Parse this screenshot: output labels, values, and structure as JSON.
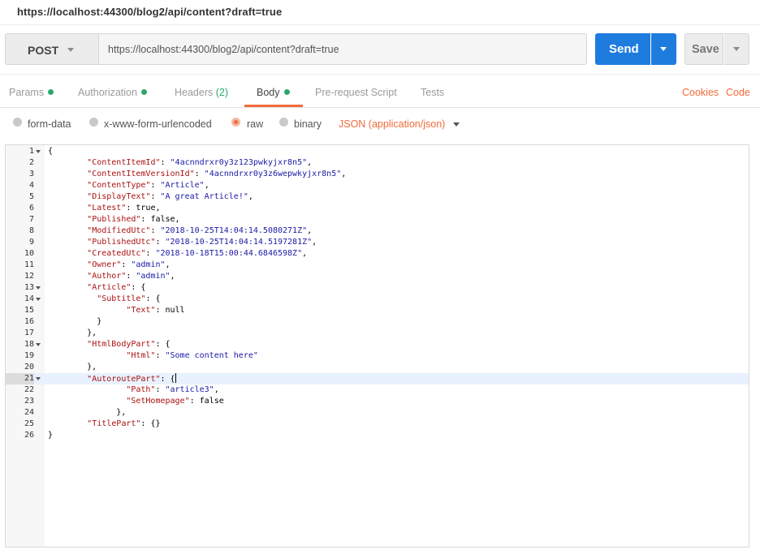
{
  "window": {
    "title": "https://localhost:44300/blog2/api/content?draft=true"
  },
  "request": {
    "method": "POST",
    "url": "https://localhost:44300/blog2/api/content?draft=true",
    "send_label": "Send",
    "save_label": "Save"
  },
  "tabs": [
    {
      "label": "Params",
      "dot": true
    },
    {
      "label": "Authorization",
      "dot": true
    },
    {
      "label": "Headers",
      "count": "(2)"
    },
    {
      "label": "Body",
      "dot": true,
      "active": true
    },
    {
      "label": "Pre-request Script"
    },
    {
      "label": "Tests"
    }
  ],
  "links": {
    "cookies": "Cookies",
    "code": "Code"
  },
  "body_types": [
    {
      "label": "form-data",
      "selected": false
    },
    {
      "label": "x-www-form-urlencoded",
      "selected": false
    },
    {
      "label": "raw",
      "selected": true
    },
    {
      "label": "binary",
      "selected": false
    }
  ],
  "raw_format": "JSON (application/json)",
  "colors": {
    "accent": "#f26b3a",
    "send": "#1f7cdf",
    "dot": "#2aa86b",
    "json_key": "#a11",
    "json_string": "#1a1aa6"
  },
  "editor": {
    "active_line": 21,
    "lines": [
      {
        "n": "1",
        "fold": true,
        "parts": [
          [
            "p",
            "{"
          ]
        ]
      },
      {
        "n": "2",
        "parts": [
          [
            "p",
            "        "
          ],
          [
            "k",
            "\"ContentItemId\""
          ],
          [
            "p",
            ": "
          ],
          [
            "s",
            "\"4acnndrxr0y3z123pwkyjxr8n5\""
          ],
          [
            "p",
            ","
          ]
        ]
      },
      {
        "n": "3",
        "parts": [
          [
            "p",
            "        "
          ],
          [
            "k",
            "\"ContentItemVersionId\""
          ],
          [
            "p",
            ": "
          ],
          [
            "s",
            "\"4acnndrxr0y3z6wepwkyjxr8n5\""
          ],
          [
            "p",
            ","
          ]
        ]
      },
      {
        "n": "4",
        "parts": [
          [
            "p",
            "        "
          ],
          [
            "k",
            "\"ContentType\""
          ],
          [
            "p",
            ": "
          ],
          [
            "s",
            "\"Article\""
          ],
          [
            "p",
            ","
          ]
        ]
      },
      {
        "n": "5",
        "parts": [
          [
            "p",
            "        "
          ],
          [
            "k",
            "\"DisplayText\""
          ],
          [
            "p",
            ": "
          ],
          [
            "s",
            "\"A great Article!\""
          ],
          [
            "p",
            ","
          ]
        ]
      },
      {
        "n": "6",
        "parts": [
          [
            "p",
            "        "
          ],
          [
            "k",
            "\"Latest\""
          ],
          [
            "p",
            ": true,"
          ]
        ]
      },
      {
        "n": "7",
        "parts": [
          [
            "p",
            "        "
          ],
          [
            "k",
            "\"Published\""
          ],
          [
            "p",
            ": false,"
          ]
        ]
      },
      {
        "n": "8",
        "parts": [
          [
            "p",
            "        "
          ],
          [
            "k",
            "\"ModifiedUtc\""
          ],
          [
            "p",
            ": "
          ],
          [
            "s",
            "\"2018-10-25T14:04:14.5080271Z\""
          ],
          [
            "p",
            ","
          ]
        ]
      },
      {
        "n": "9",
        "parts": [
          [
            "p",
            "        "
          ],
          [
            "k",
            "\"PublishedUtc\""
          ],
          [
            "p",
            ": "
          ],
          [
            "s",
            "\"2018-10-25T14:04:14.5197281Z\""
          ],
          [
            "p",
            ","
          ]
        ]
      },
      {
        "n": "10",
        "parts": [
          [
            "p",
            "        "
          ],
          [
            "k",
            "\"CreatedUtc\""
          ],
          [
            "p",
            ": "
          ],
          [
            "s",
            "\"2018-10-18T15:00:44.6846598Z\""
          ],
          [
            "p",
            ","
          ]
        ]
      },
      {
        "n": "11",
        "parts": [
          [
            "p",
            "        "
          ],
          [
            "k",
            "\"Owner\""
          ],
          [
            "p",
            ": "
          ],
          [
            "s",
            "\"admin\""
          ],
          [
            "p",
            ","
          ]
        ]
      },
      {
        "n": "12",
        "parts": [
          [
            "p",
            "        "
          ],
          [
            "k",
            "\"Author\""
          ],
          [
            "p",
            ": "
          ],
          [
            "s",
            "\"admin\""
          ],
          [
            "p",
            ","
          ]
        ]
      },
      {
        "n": "13",
        "fold": true,
        "parts": [
          [
            "p",
            "        "
          ],
          [
            "k",
            "\"Article\""
          ],
          [
            "p",
            ": {"
          ]
        ]
      },
      {
        "n": "14",
        "fold": true,
        "parts": [
          [
            "p",
            "          "
          ],
          [
            "k",
            "\"Subtitle\""
          ],
          [
            "p",
            ": {"
          ]
        ]
      },
      {
        "n": "15",
        "parts": [
          [
            "p",
            "                "
          ],
          [
            "k",
            "\"Text\""
          ],
          [
            "p",
            ": null"
          ]
        ]
      },
      {
        "n": "16",
        "parts": [
          [
            "p",
            "          }"
          ]
        ]
      },
      {
        "n": "17",
        "parts": [
          [
            "p",
            "        },"
          ]
        ]
      },
      {
        "n": "18",
        "fold": true,
        "parts": [
          [
            "p",
            "        "
          ],
          [
            "k",
            "\"HtmlBodyPart\""
          ],
          [
            "p",
            ": {"
          ]
        ]
      },
      {
        "n": "19",
        "parts": [
          [
            "p",
            "                "
          ],
          [
            "k",
            "\"Html\""
          ],
          [
            "p",
            ": "
          ],
          [
            "s",
            "\"Some content here\""
          ]
        ]
      },
      {
        "n": "20",
        "parts": [
          [
            "p",
            "        },"
          ]
        ]
      },
      {
        "n": "21",
        "fold": true,
        "cursor": true,
        "parts": [
          [
            "p",
            "        "
          ],
          [
            "k",
            "\"AutoroutePart\""
          ],
          [
            "p",
            ": {"
          ]
        ]
      },
      {
        "n": "22",
        "parts": [
          [
            "p",
            "                "
          ],
          [
            "k",
            "\"Path\""
          ],
          [
            "p",
            ": "
          ],
          [
            "s",
            "\"article3\""
          ],
          [
            "p",
            ","
          ]
        ]
      },
      {
        "n": "23",
        "parts": [
          [
            "p",
            "                "
          ],
          [
            "k",
            "\"SetHomepage\""
          ],
          [
            "p",
            ": false"
          ]
        ]
      },
      {
        "n": "24",
        "parts": [
          [
            "p",
            "              },"
          ]
        ]
      },
      {
        "n": "25",
        "parts": [
          [
            "p",
            "        "
          ],
          [
            "k",
            "\"TitlePart\""
          ],
          [
            "p",
            ": {}"
          ]
        ]
      },
      {
        "n": "26",
        "parts": [
          [
            "p",
            "}"
          ]
        ]
      }
    ]
  }
}
